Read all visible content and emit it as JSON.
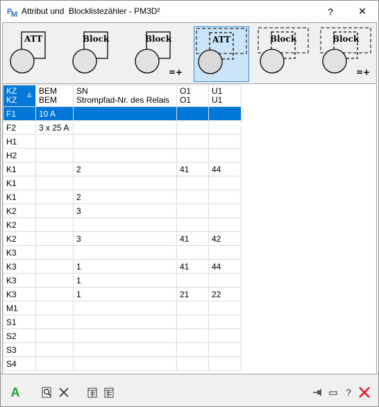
{
  "window": {
    "title": "Attribut und  Blocklistezähler - PM3D²",
    "help_glyph": "?",
    "close_glyph": "✕",
    "app_icon": "pm-logo-icon"
  },
  "toolbar": {
    "buttons": [
      {
        "label": "ATT",
        "style": "solid",
        "suffix": ""
      },
      {
        "label": "Block",
        "style": "solid",
        "suffix": ""
      },
      {
        "label": "Block",
        "style": "solid",
        "suffix": "=+"
      },
      {
        "label": "ATT",
        "style": "dashed",
        "suffix": "",
        "active": true
      },
      {
        "label": "Block",
        "style": "dashed",
        "suffix": ""
      },
      {
        "label": "Block",
        "style": "dashed",
        "suffix": "=+"
      }
    ]
  },
  "grid": {
    "columns": [
      {
        "line1": "KZ",
        "line2": "KZ",
        "sorted": true
      },
      {
        "line1": "BEM",
        "line2": "BEM"
      },
      {
        "line1": "SN",
        "line2": "Strompfad-Nr. des Relais"
      },
      {
        "line1": "O1",
        "line2": "O1"
      },
      {
        "line1": "U1",
        "line2": "U1"
      }
    ],
    "sort_indicator": "∆",
    "rows": [
      [
        "F1",
        "10 A",
        "",
        "",
        ""
      ],
      [
        "F2",
        "3 x 25 A",
        "",
        "",
        ""
      ],
      [
        "H1",
        "",
        "",
        "",
        ""
      ],
      [
        "H2",
        "",
        "",
        "",
        ""
      ],
      [
        "K1",
        "",
        "2",
        "41",
        "44"
      ],
      [
        "K1",
        "",
        "",
        "",
        ""
      ],
      [
        "K1",
        "",
        "2",
        "",
        ""
      ],
      [
        "K2",
        "",
        "3",
        "",
        ""
      ],
      [
        "K2",
        "",
        "",
        "",
        ""
      ],
      [
        "K2",
        "",
        "3",
        "41",
        "42"
      ],
      [
        "K3",
        "",
        "",
        "",
        ""
      ],
      [
        "K3",
        "",
        "1",
        "41",
        "44"
      ],
      [
        "K3",
        "",
        "1",
        "",
        ""
      ],
      [
        "K3",
        "",
        "1",
        "21",
        "22"
      ],
      [
        "M1",
        "",
        "",
        "",
        ""
      ],
      [
        "S1",
        "",
        "",
        "",
        ""
      ],
      [
        "S2",
        "",
        "",
        "",
        ""
      ],
      [
        "S3",
        "",
        "",
        "",
        ""
      ],
      [
        "S4",
        "",
        "",
        "",
        ""
      ]
    ],
    "selected_row": 0
  },
  "bottombar": {
    "font_icon_glyph": "A",
    "help_glyph": "?",
    "icons": [
      "font-icon",
      "zoom-icon",
      "clear-icon",
      "export-list-icon",
      "import-list-icon",
      "pin-icon",
      "minimize-icon",
      "help-icon",
      "close-red-icon"
    ]
  },
  "colors": {
    "accent": "#0078d7",
    "active_tool_bg": "#cce4f7",
    "font_icon": "#1a9c3a",
    "close_red": "#e81123"
  }
}
